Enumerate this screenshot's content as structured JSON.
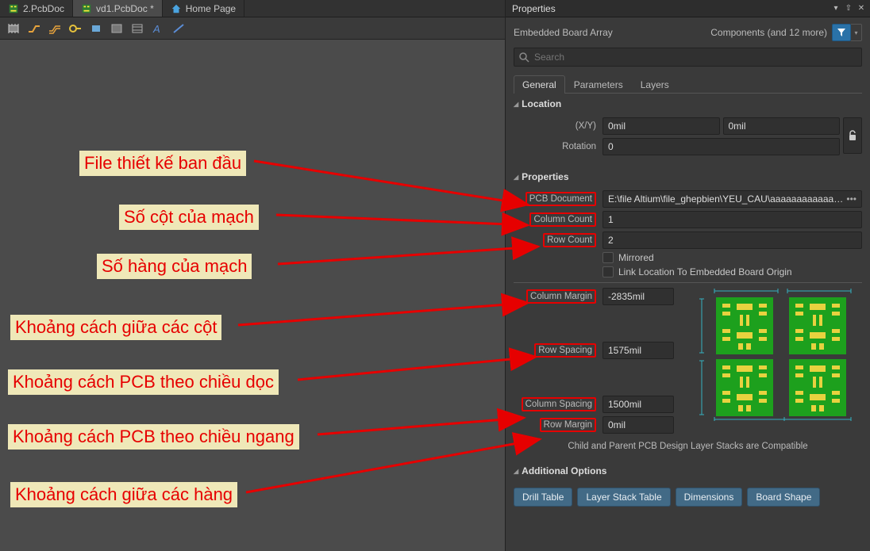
{
  "tabs": {
    "t0": "2.PcbDoc",
    "t1": "vd1.PcbDoc *",
    "t2": "Home Page"
  },
  "panel": {
    "title": "Properties",
    "objtype": "Embedded Board Array",
    "filter_summary": "Components (and 12 more)",
    "search_placeholder": "Search",
    "tab_general": "General",
    "tab_parameters": "Parameters",
    "tab_layers": "Layers"
  },
  "sections": {
    "location": "Location",
    "properties": "Properties",
    "additional": "Additional Options"
  },
  "location": {
    "xy_label": "(X/Y)",
    "x": "0mil",
    "y": "0mil",
    "rotation_label": "Rotation",
    "rotation": "0"
  },
  "props": {
    "pcb_document_label": "PCB Document",
    "pcb_document": "E:\\file Altium\\file_ghepbien\\YEU_CAU\\aaaaaaaaaaaaaaa",
    "column_count_label": "Column Count",
    "column_count": "1",
    "row_count_label": "Row Count",
    "row_count": "2",
    "mirrored_label": "Mirrored",
    "link_label": "Link Location To Embedded Board Origin",
    "column_margin_label": "Column Margin",
    "column_margin": "-2835mil",
    "row_spacing_label": "Row Spacing",
    "row_spacing": "1575mil",
    "column_spacing_label": "Column Spacing",
    "column_spacing": "1500mil",
    "row_margin_label": "Row Margin",
    "row_margin": "0mil"
  },
  "compat": "Child and Parent PCB Design Layer Stacks are Compatible",
  "buttons": {
    "drill": "Drill Table",
    "layerstack": "Layer Stack Table",
    "dimensions": "Dimensions",
    "boardshape": "Board Shape"
  },
  "annotations": {
    "a1": "File thiết kế ban đầu",
    "a2": "Số cột của mạch",
    "a3": "Số hàng của mạch",
    "a4": "Khoảng cách giữa các cột",
    "a5": "Khoảng cách PCB theo chiều dọc",
    "a6": "Khoảng cách PCB theo chiều ngang",
    "a7": "Khoảng cách giữa các hàng"
  }
}
